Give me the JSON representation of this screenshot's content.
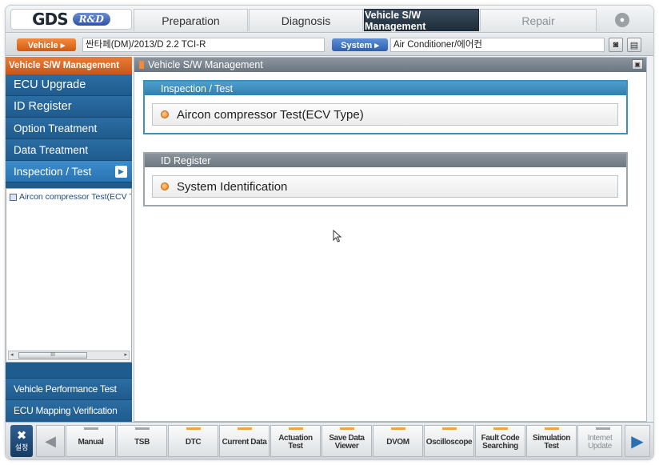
{
  "app": {
    "logo_main": "GDS",
    "logo_badge": "R&D"
  },
  "tabs": [
    {
      "label": "Preparation",
      "state": "normal"
    },
    {
      "label": "Diagnosis",
      "state": "normal"
    },
    {
      "label": "Vehicle S/W Management",
      "state": "active"
    },
    {
      "label": "Repair",
      "state": "disabled"
    }
  ],
  "vehicle_bar": {
    "vehicle_label": "Vehicle ▸",
    "vehicle_value": "싼타페(DM)/2013/D 2.2 TCI-R",
    "system_label": "System ▸",
    "system_value": "Air Conditioner/에어컨"
  },
  "sidebar": {
    "header": "Vehicle S/W Management",
    "items": [
      {
        "label": "ECU Upgrade",
        "active": false
      },
      {
        "label": "ID Register",
        "active": false
      },
      {
        "label": "Option Treatment",
        "active": false
      },
      {
        "label": "Data Treatment",
        "active": false
      },
      {
        "label": "Inspection / Test",
        "active": true
      }
    ],
    "tree_items": [
      "Aircon compressor Test(ECV Type)"
    ],
    "scroll_thumb": "III",
    "bottom_items": [
      "Vehicle Performance Test",
      "ECU Mapping Verification"
    ]
  },
  "main": {
    "header": "Vehicle S/W Management",
    "groups": [
      {
        "title": "Inspection / Test",
        "button": "Aircon compressor Test(ECV Type)"
      },
      {
        "title": "ID Register",
        "button": "System Identification"
      }
    ]
  },
  "toolbar": {
    "settings_label": "설정",
    "tools": [
      {
        "label": "Manual",
        "on": false
      },
      {
        "label": "TSB",
        "on": false
      },
      {
        "label": "DTC",
        "on": true
      },
      {
        "label": "Current Data",
        "on": true
      },
      {
        "label": "Actuation\nTest",
        "on": true
      },
      {
        "label": "Save Data\nViewer",
        "on": true
      },
      {
        "label": "DVOM",
        "on": true
      },
      {
        "label": "Oscilloscope",
        "on": true
      },
      {
        "label": "Fault Code\nSearching",
        "on": true
      },
      {
        "label": "Simulation\nTest",
        "on": true
      },
      {
        "label": "Internet\nUpdate",
        "on": false
      }
    ]
  },
  "colors": {
    "accent_orange": "#e2702a",
    "sidebar_blue": "#1f5b8d",
    "active_tab": "#1e2b37",
    "group_blue": "#3f8fbd"
  }
}
